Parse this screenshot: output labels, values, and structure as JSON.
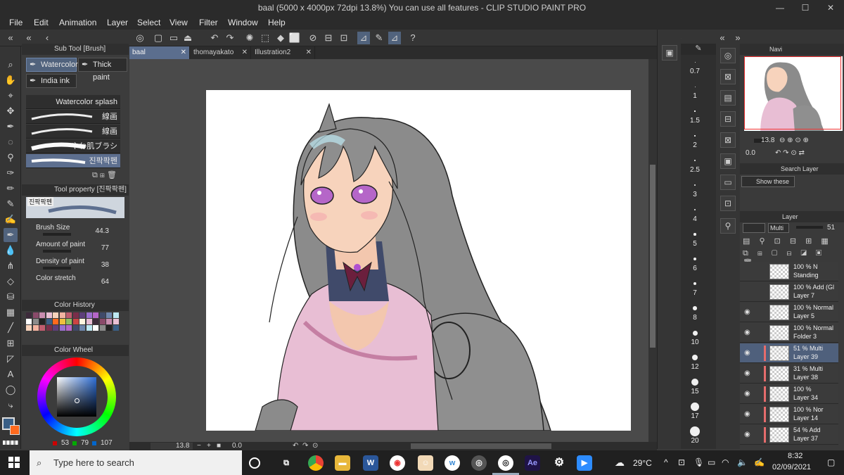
{
  "window": {
    "title": "baal (5000 x 4000px 72dpi 13.8%)  You can use all features - CLIP STUDIO PAINT PRO",
    "minimize": "—",
    "maximize": "☐",
    "close": "✕"
  },
  "menu": [
    "File",
    "Edit",
    "Animation",
    "Layer",
    "Select",
    "View",
    "Filter",
    "Window",
    "Help"
  ],
  "sub_tool": {
    "header": "Sub Tool [Brush]",
    "tabs": [
      {
        "label": "Watercolor"
      },
      {
        "label": "Thick paint"
      },
      {
        "label": "India ink"
      }
    ],
    "brushes": [
      "Watercolor splash",
      "線画",
      "線画",
      "やわ肌ブラシ",
      "진팍팍펜"
    ]
  },
  "tool_property": {
    "header": "Tool property [진팍팍펜]",
    "preview_label": "진팍팍펜",
    "props": [
      {
        "label": "Brush Size",
        "value": "44.3"
      },
      {
        "label": "Amount of paint",
        "value": "77"
      },
      {
        "label": "Density of paint",
        "value": "38"
      },
      {
        "label": "Color stretch",
        "value": "64"
      }
    ]
  },
  "color_history": {
    "header": "Color History"
  },
  "color_wheel": {
    "header": "Color Wheel",
    "r": "53",
    "g": "79",
    "b": "107"
  },
  "tabs": [
    {
      "label": "baal"
    },
    {
      "label": "thomayakato"
    },
    {
      "label": "Illustration2"
    }
  ],
  "status": {
    "zoom": "13.8",
    "rotation": "0.0"
  },
  "brush_sizes": [
    "0.7",
    "1",
    "1.5",
    "2",
    "2.5",
    "3",
    "4",
    "5",
    "6",
    "7",
    "8",
    "10",
    "12",
    "15",
    "17",
    "20"
  ],
  "navigator": {
    "header": "Navi",
    "zoom": "13.8",
    "angle": "0.0"
  },
  "search_layer": {
    "header": "Search Layer",
    "show_these": "Show these"
  },
  "layer_panel": {
    "header": "Layer",
    "blend": "Multi",
    "opacity": "51",
    "layers": [
      {
        "line1": "100 % N",
        "line2": "Standing"
      },
      {
        "line1": "100 % Add (Gl",
        "line2": "Layer 7"
      },
      {
        "line1": "100 % Normal",
        "line2": "Layer 5"
      },
      {
        "line1": "100 % Normal",
        "line2": "Folder 3"
      },
      {
        "line1": "51 % Multi",
        "line2": "Layer 39"
      },
      {
        "line1": "31 % Multi",
        "line2": "Layer 38"
      },
      {
        "line1": "100 %",
        "line2": "Layer 34"
      },
      {
        "line1": "100 % Nor",
        "line2": "Layer 14"
      },
      {
        "line1": "54 % Add",
        "line2": "Layer 37"
      }
    ]
  },
  "taskbar": {
    "search_placeholder": "Type here to search",
    "weather": "29°C",
    "time": "8:32",
    "date": "02/09/2021"
  },
  "colors": {
    "accent": "#51637d",
    "panel": "#3a3a3a",
    "dark": "#2b2b2b",
    "hair": "#8a8a8a",
    "skin": "#f5cdb5",
    "kimono": "#e7bcd4"
  }
}
